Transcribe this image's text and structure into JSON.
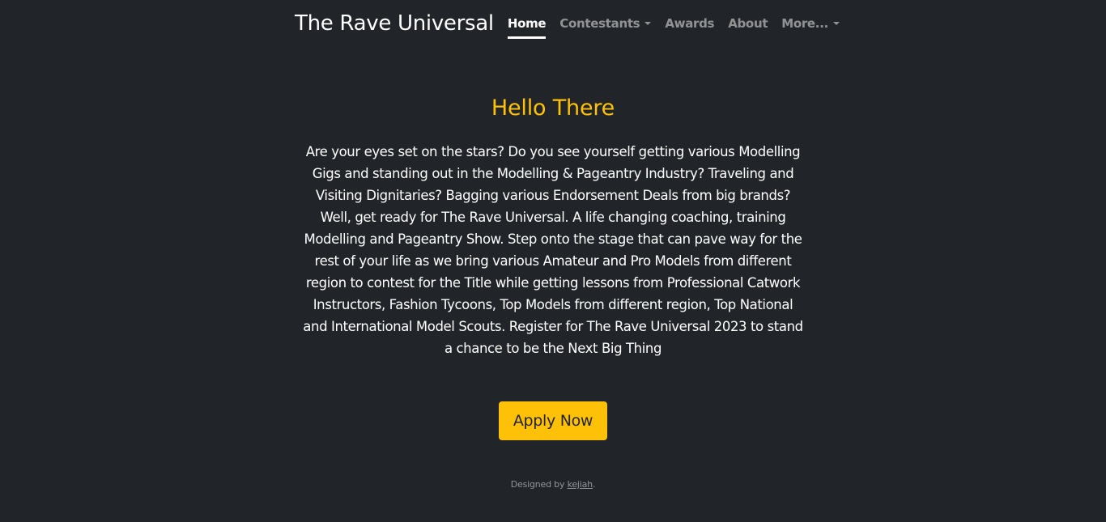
{
  "brand": "The Rave Universal",
  "nav": {
    "home": "Home",
    "contestants": "Contestants",
    "awards": "Awards",
    "about": "About",
    "more": "More..."
  },
  "hero": {
    "title": "Hello There",
    "lead": "Are your eyes set on the stars? Do you see yourself getting various Modelling Gigs and standing out in the Modelling & Pageantry Industry? Traveling and Visiting Dignitaries? Bagging various Endorsement Deals from big brands? Well, get ready for The Rave Universal. A life changing coaching, training Modelling and Pageantry Show. Step onto the stage that can pave way for the rest of your life as we bring various Amateur and Pro Models from different region to contest for the Title while getting lessons from Professional Catwork Instructors, Fashion Tycoons, Top Models from different region, Top National and International Model Scouts. Register for The Rave Universal 2023 to stand a chance to be the Next Big Thing",
    "cta": "Apply Now"
  },
  "footer": {
    "prefix": "Designed by ",
    "link": "kejiah",
    "suffix": "."
  },
  "colors": {
    "background": "#212529",
    "accent": "#ffc107"
  }
}
